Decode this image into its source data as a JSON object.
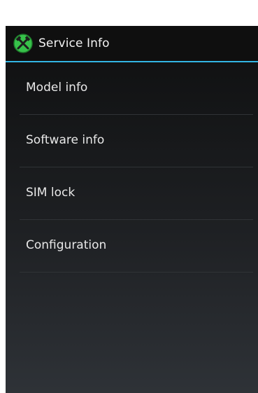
{
  "action_bar": {
    "title": "Service Info",
    "icon": "crossed-tools-icon",
    "accent_color": "#33b5e5"
  },
  "menu": {
    "items": [
      {
        "label": "Model info"
      },
      {
        "label": "Software info"
      },
      {
        "label": "SIM lock"
      },
      {
        "label": "Configuration"
      }
    ]
  }
}
